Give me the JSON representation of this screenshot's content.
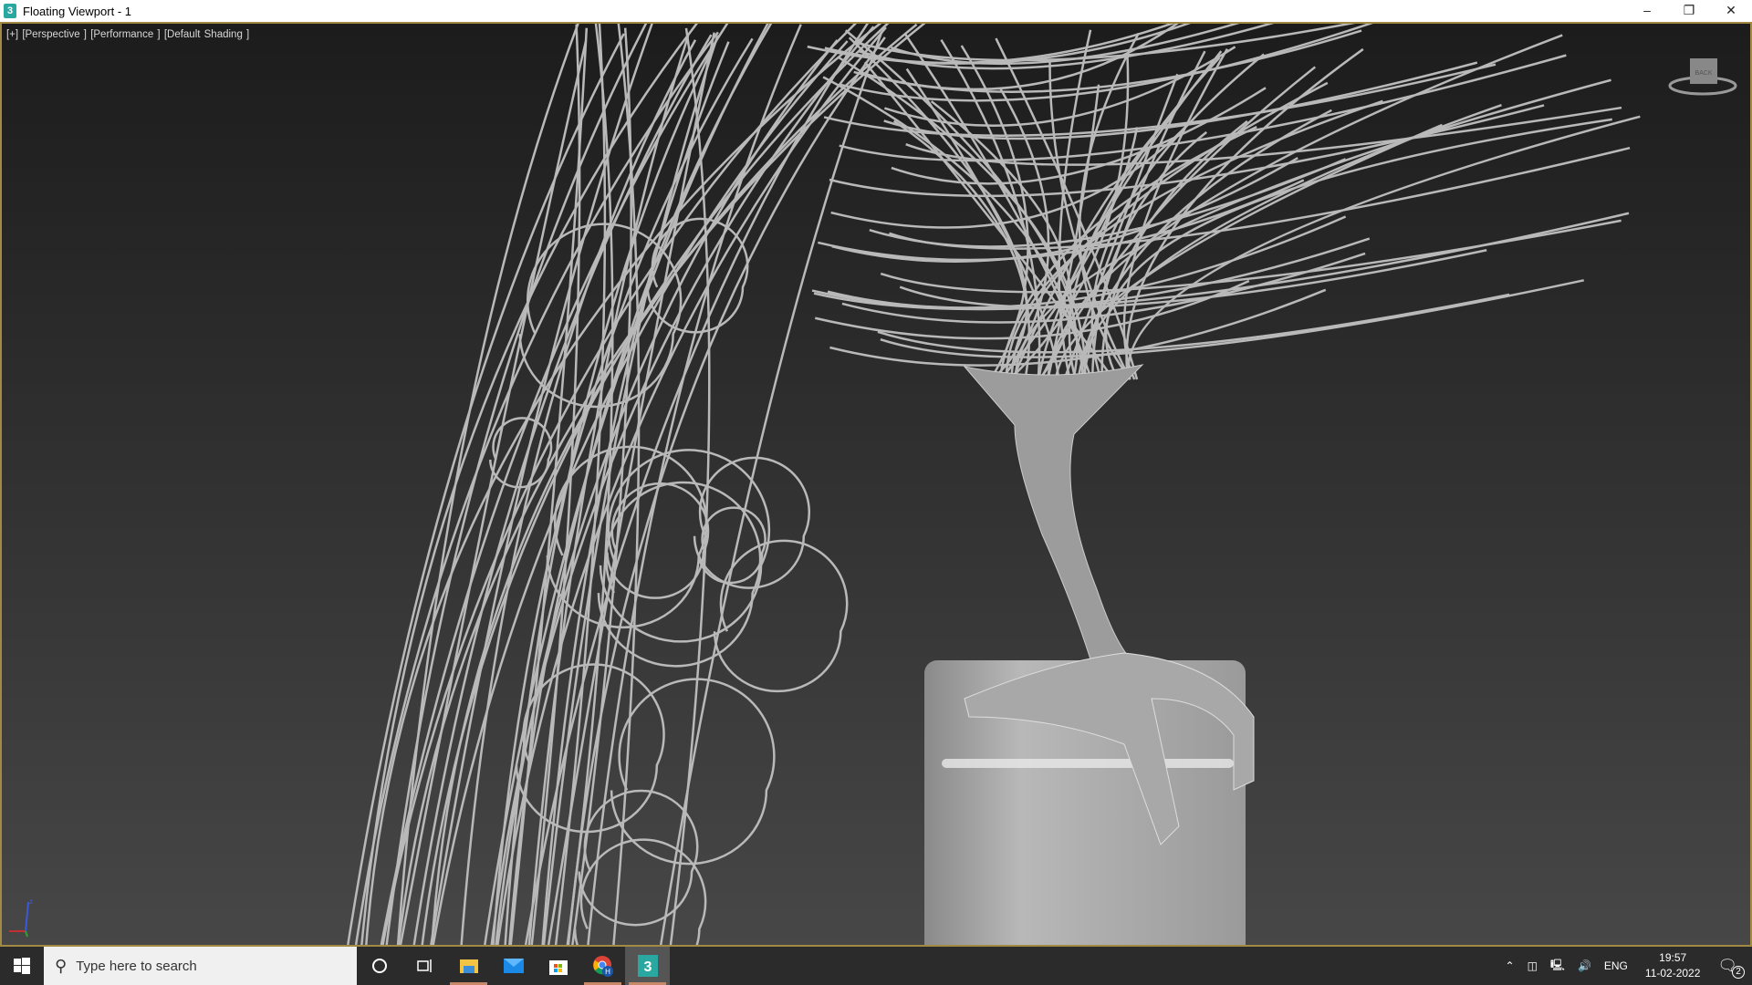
{
  "window": {
    "title": "Floating Viewport - 1",
    "app_icon": "3ds-max-icon",
    "controls": [
      "minimize",
      "restore",
      "close"
    ]
  },
  "viewport": {
    "labels": [
      "[+]",
      "[Perspective ]",
      "[Performance ]",
      "[Default Shading ]"
    ],
    "viewcube_face": "BACK",
    "gizmo_axis": "z"
  },
  "taskbar": {
    "search_placeholder": "Type here to search",
    "apps": [
      "cortana-icon",
      "task-view-icon",
      "file-explorer-icon",
      "mail-icon",
      "store-icon",
      "chrome-icon",
      "3ds-max-icon"
    ],
    "chrome_badge": "H",
    "tray": {
      "language": "ENG",
      "time": "19:57",
      "date": "11-02-2022",
      "notification_count": "2"
    }
  }
}
